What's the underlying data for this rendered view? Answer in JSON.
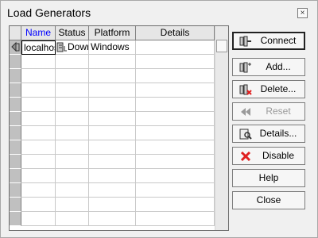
{
  "window": {
    "title": "Load Generators",
    "close_glyph": "×"
  },
  "grid": {
    "columns": [
      "Name",
      "Status",
      "Platform",
      "Details"
    ],
    "rows": [
      {
        "name": "localhost",
        "status": "Down",
        "platform": "Windows",
        "details": ""
      }
    ]
  },
  "buttons": [
    {
      "id": "connect",
      "label": "Connect",
      "icon": "connect-icon",
      "enabled": true,
      "focused": true
    },
    {
      "id": "add",
      "label": "Add...",
      "icon": "add-generator-icon",
      "enabled": true
    },
    {
      "id": "delete",
      "label": "Delete...",
      "icon": "delete-generator-icon",
      "enabled": true
    },
    {
      "id": "reset",
      "label": "Reset",
      "icon": "reset-icon",
      "enabled": false
    },
    {
      "id": "details",
      "label": "Details...",
      "icon": "details-icon",
      "enabled": true
    },
    {
      "id": "disable",
      "label": "Disable",
      "icon": "disable-x-icon",
      "enabled": true
    },
    {
      "id": "help",
      "label": "Help",
      "enabled": true
    },
    {
      "id": "close",
      "label": "Close",
      "enabled": true
    }
  ],
  "colors": {
    "selected_header": "#0000ff",
    "disable_x": "#e02020"
  }
}
